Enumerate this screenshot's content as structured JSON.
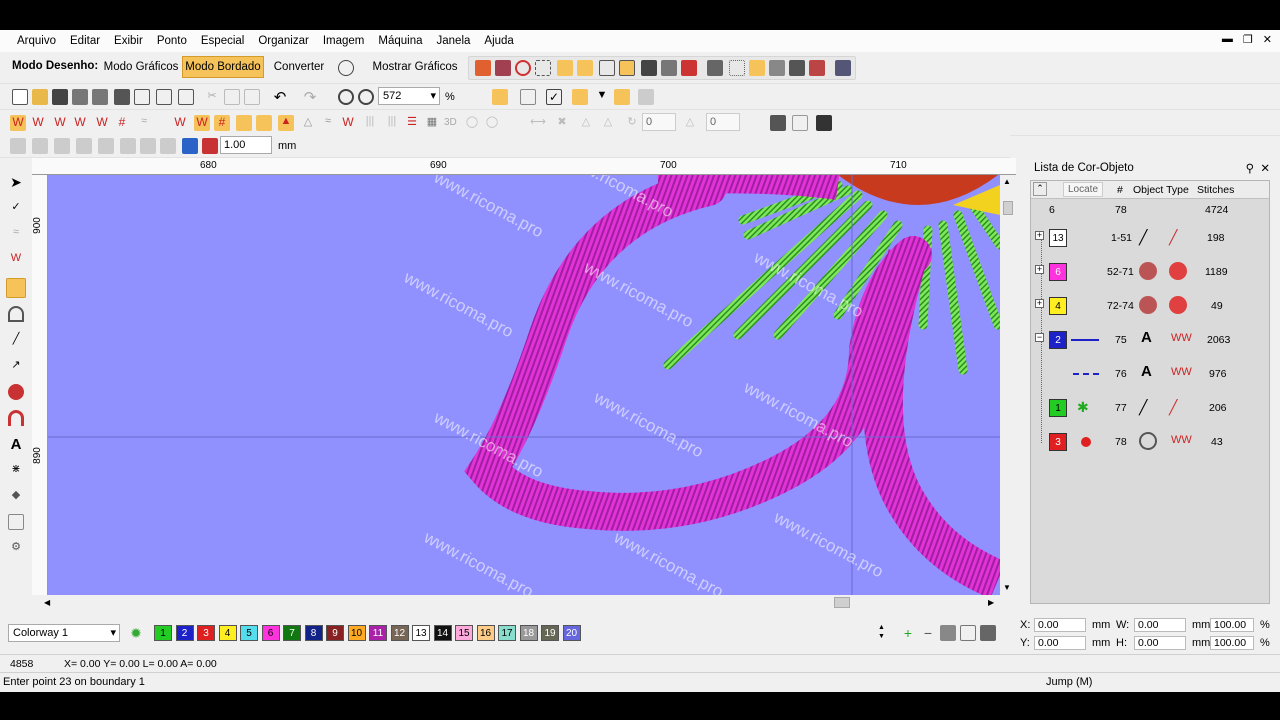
{
  "menu": [
    "Arquivo",
    "Editar",
    "Exibir",
    "Ponto",
    "Especial",
    "Organizar",
    "Imagem",
    "Máquina",
    "Janela",
    "Ajuda"
  ],
  "mode": {
    "label": "Modo Desenho:",
    "graphics": "Modo Gráficos",
    "embroidery": "Modo Bordado",
    "convert": "Converter",
    "show_graphics": "Mostrar Gráficos"
  },
  "zoom": {
    "value": "572",
    "unit": "%"
  },
  "stitch_width": {
    "value": "1.00",
    "unit": "mm"
  },
  "angle_fields": [
    "0",
    "0"
  ],
  "ruler": {
    "h": [
      "680",
      "690",
      "700",
      "710"
    ],
    "v": [
      "900",
      "890"
    ]
  },
  "watermark": "www.ricoma.pro",
  "panel": {
    "title": "Lista de Cor-Objeto",
    "col_locate": "Locate",
    "col_num": "#",
    "col_type": "Object Type",
    "col_stitches": "Stitches",
    "summary": {
      "count": "6",
      "num": "78",
      "stitches": "4724"
    },
    "rows": [
      {
        "color": "13",
        "range": "1-51",
        "stitches": "198",
        "bg": "#ffffff",
        "fg": "#000"
      },
      {
        "color": "6",
        "range": "52-71",
        "stitches": "1189",
        "bg": "#ff33dd",
        "fg": "#fff"
      },
      {
        "color": "4",
        "range": "72-74",
        "stitches": "49",
        "bg": "#ffee22",
        "fg": "#000"
      },
      {
        "color": "2",
        "range": "75",
        "stitches": "2063",
        "bg": "#1d22c8",
        "fg": "#fff"
      },
      {
        "color": "",
        "range": "76",
        "stitches": "976",
        "bg": "",
        "fg": "#000"
      },
      {
        "color": "1",
        "range": "77",
        "stitches": "206",
        "bg": "#22cc22",
        "fg": "#000"
      },
      {
        "color": "3",
        "range": "78",
        "stitches": "43",
        "bg": "#e02020",
        "fg": "#fff"
      }
    ]
  },
  "colorway": "Colorway 1",
  "palette": [
    {
      "n": "1",
      "c": "#22cc22"
    },
    {
      "n": "2",
      "c": "#1d22c8"
    },
    {
      "n": "3",
      "c": "#e02020"
    },
    {
      "n": "4",
      "c": "#ffee22"
    },
    {
      "n": "5",
      "c": "#55ddee"
    },
    {
      "n": "6",
      "c": "#ff33dd"
    },
    {
      "n": "7",
      "c": "#117711"
    },
    {
      "n": "8",
      "c": "#112288"
    },
    {
      "n": "9",
      "c": "#882222"
    },
    {
      "n": "10",
      "c": "#ffaa22"
    },
    {
      "n": "11",
      "c": "#aa22aa"
    },
    {
      "n": "12",
      "c": "#776655"
    },
    {
      "n": "13",
      "c": "#ffffff"
    },
    {
      "n": "14",
      "c": "#111111"
    },
    {
      "n": "15",
      "c": "#ffaadd"
    },
    {
      "n": "16",
      "c": "#ffcc88"
    },
    {
      "n": "17",
      "c": "#88ddcc"
    },
    {
      "n": "18",
      "c": "#999999"
    },
    {
      "n": "19",
      "c": "#666655"
    },
    {
      "n": "20",
      "c": "#6666dd"
    }
  ],
  "coords": {
    "x_label": "X:",
    "y_label": "Y:",
    "w_label": "W:",
    "h_label": "H:",
    "x": "0.00",
    "y": "0.00",
    "w": "0.00",
    "h": "0.00",
    "unit": "mm",
    "pw": "100.00",
    "ph": "100.00",
    "pct": "%"
  },
  "status": {
    "stitch": "4858",
    "xy": "X=  0.00 Y=  0.00 L=  0.00 A=  0.00",
    "prompt": "Enter point 23 on boundary 1",
    "mode": "Jump (M)"
  }
}
